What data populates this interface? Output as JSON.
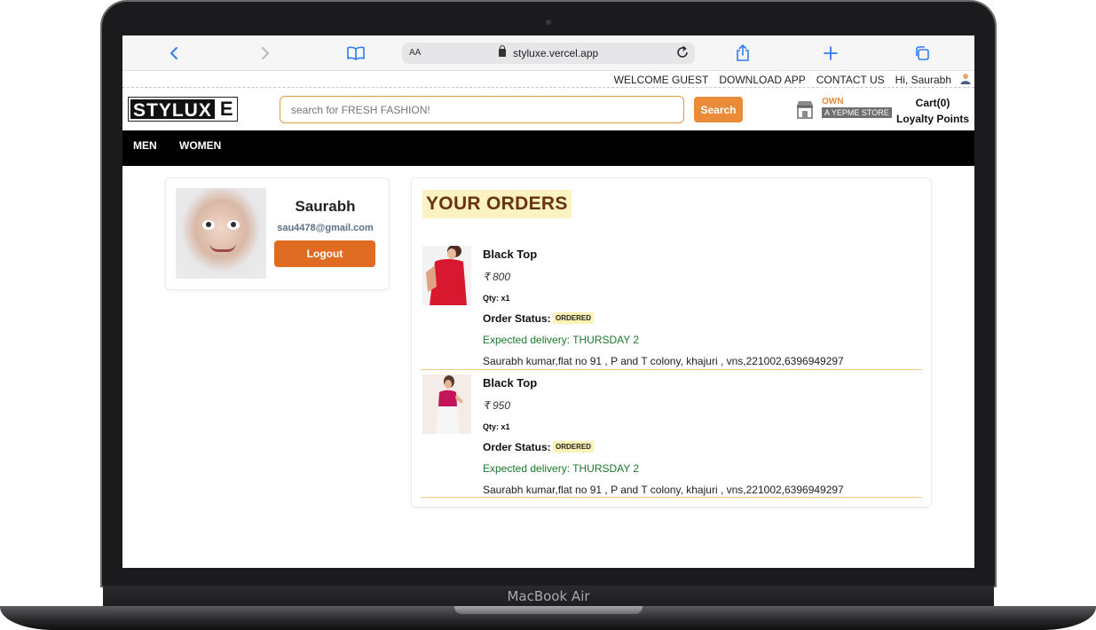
{
  "device": {
    "label": "MacBook Air"
  },
  "browser": {
    "url": "styluxe.vercel.app",
    "text_size_label": "AA"
  },
  "toplinks": {
    "items": [
      "WELCOME GUEST",
      "DOWNLOAD APP",
      "CONTACT US",
      "Hi, Saurabh"
    ]
  },
  "header": {
    "logo_main": "STYLUX",
    "logo_last": "E",
    "search_placeholder": "search for FRESH FASHION!",
    "search_button": "Search",
    "own_label": "OWN",
    "store_label": "A YEPME STORE",
    "cart_label": "Cart(0)",
    "loyalty_label": "Loyalty Points"
  },
  "nav": {
    "items": [
      "MEN",
      "WOMEN"
    ]
  },
  "profile": {
    "name": "Saurabh",
    "email": "sau4478@gmail.com",
    "logout_label": "Logout"
  },
  "orders": {
    "title": "YOUR ORDERS",
    "status_label": "Order Status:",
    "items": [
      {
        "name": "Black Top",
        "price": "₹ 800",
        "qty": "Qty: x1",
        "status": "ORDERED",
        "delivery": "Expected delivery: THURSDAY 2",
        "address": "Saurabh kumar,flat no 91 , P and T colony, khajuri , vns,221002,6396949297",
        "image_colors": {
          "top": "#d8182e",
          "bg": "#f3f3f3"
        }
      },
      {
        "name": "Black Top",
        "price": "₹ 950",
        "qty": "Qty: x1",
        "status": "ORDERED",
        "delivery": "Expected delivery: THURSDAY 2",
        "address": "Saurabh kumar,flat no 91 , P and T colony, khajuri , vns,221002,6396949297",
        "image_colors": {
          "top": "#c4155a",
          "bg": "#f4ece6"
        }
      }
    ]
  },
  "colors": {
    "accent_orange": "#ea8b39",
    "logout_orange": "#e06b22",
    "nav_black": "#000000",
    "delivery_green": "#1b7a2a",
    "title_bg": "#fdf3c2",
    "title_text": "#6a3310"
  }
}
